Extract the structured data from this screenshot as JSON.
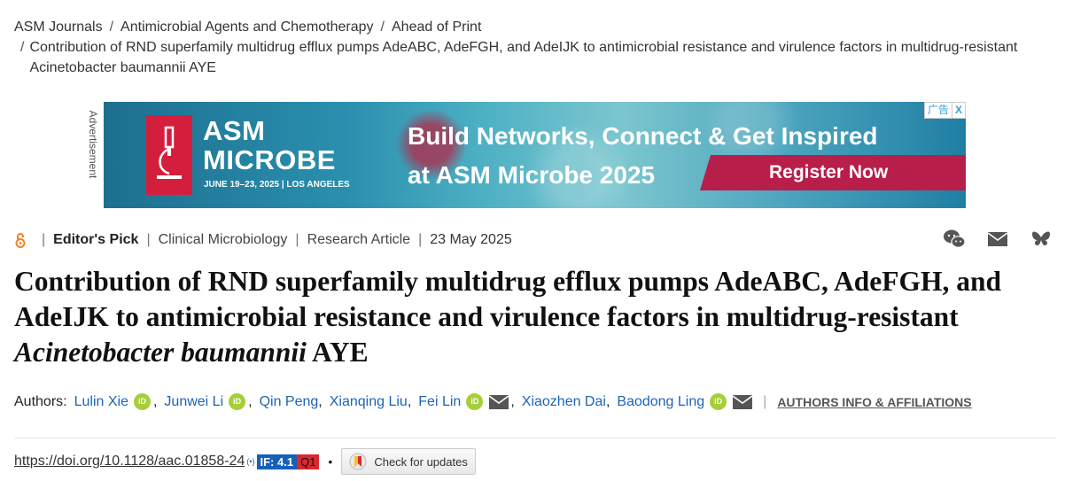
{
  "breadcrumb": {
    "items": [
      "ASM Journals",
      "Antimicrobial Agents and Chemotherapy",
      "Ahead of Print"
    ],
    "article": "Contribution of RND superfamily multidrug efflux pumps AdeABC, AdeFGH, and AdeIJK to antimicrobial resistance and virulence factors in multidrug-resistant Acinetobacter baumannii AYE"
  },
  "ad": {
    "label": "Advertisement",
    "brand_line1": "ASM",
    "brand_line2": "MICROBE",
    "date_location": "JUNE 19–23, 2025 | LOS ANGELES",
    "headline_line1": "Build Networks, Connect & Get Inspired",
    "headline_line2": "at ASM Microbe 2025",
    "cta": "Register Now",
    "ad_choice": "广告",
    "close": "X"
  },
  "meta": {
    "editor_pick": "Editor's Pick",
    "category": "Clinical Microbiology",
    "type": "Research Article",
    "date": "23 May 2025"
  },
  "title": {
    "part1": "Contribution of RND superfamily multidrug efflux pumps AdeABC, AdeFGH, and AdeIJK to antimicrobial resistance and virulence factors in multidrug-resistant ",
    "italic": "Acinetobacter baumannii",
    "part2": " AYE"
  },
  "authors": {
    "label": "Authors:",
    "names": [
      "Lulin Xie",
      "Junwei Li",
      "Qin Peng",
      "Xianqing Liu",
      "Fei Lin",
      "Xiaozhen Dai",
      "Baodong Ling"
    ],
    "orcid_text": "iD",
    "affiliations_link": "AUTHORS INFO & AFFILIATIONS"
  },
  "doi": {
    "link": "https://doi.org/10.1128/aac.01858-24",
    "radio": "(•)",
    "impact_factor": "IF: 4.1",
    "quartile": "Q1",
    "dot": "•",
    "check_updates": "Check for updates"
  },
  "colors": {
    "link_blue": "#1d64b5",
    "orcid_green": "#a6ce39",
    "ad_red": "#d31f3d",
    "if_blue": "#1560b8",
    "q_red": "#d9272e"
  }
}
